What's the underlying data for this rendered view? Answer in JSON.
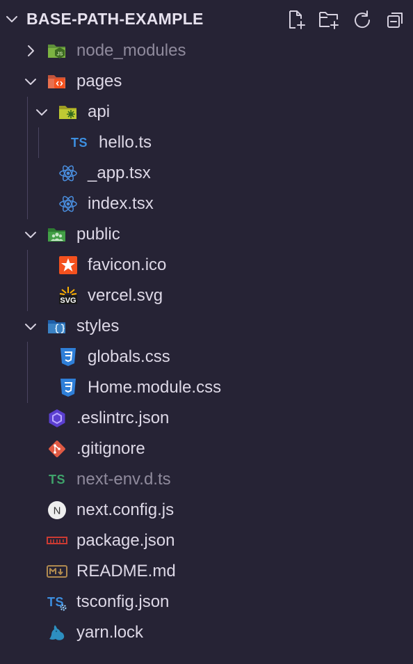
{
  "explorer": {
    "title": "BASE-PATH-EXAMPLE",
    "actions": [
      {
        "name": "new-file-button",
        "icon": "new-file-icon"
      },
      {
        "name": "new-folder-button",
        "icon": "new-folder-icon"
      },
      {
        "name": "refresh-button",
        "icon": "refresh-icon"
      },
      {
        "name": "collapse-all-button",
        "icon": "collapse-all-icon"
      }
    ]
  },
  "tree": [
    {
      "label": "node_modules",
      "type": "folder",
      "expanded": false,
      "icon": "nodejs-folder-icon",
      "dimmed": true
    },
    {
      "label": "pages",
      "type": "folder",
      "expanded": true,
      "icon": "pages-folder-icon"
    },
    {
      "label": "api",
      "type": "folder",
      "expanded": true,
      "icon": "api-folder-icon"
    },
    {
      "label": "hello.ts",
      "type": "file",
      "icon": "typescript-icon"
    },
    {
      "label": "_app.tsx",
      "type": "file",
      "icon": "react-icon"
    },
    {
      "label": "index.tsx",
      "type": "file",
      "icon": "react-icon"
    },
    {
      "label": "public",
      "type": "folder",
      "expanded": true,
      "icon": "public-folder-icon"
    },
    {
      "label": "favicon.ico",
      "type": "file",
      "icon": "favicon-icon"
    },
    {
      "label": "vercel.svg",
      "type": "file",
      "icon": "svg-icon",
      "icon_text": "SVG"
    },
    {
      "label": "styles",
      "type": "folder",
      "expanded": true,
      "icon": "styles-folder-icon"
    },
    {
      "label": "globals.css",
      "type": "file",
      "icon": "css-icon"
    },
    {
      "label": "Home.module.css",
      "type": "file",
      "icon": "css-icon"
    },
    {
      "label": ".eslintrc.json",
      "type": "file",
      "icon": "eslint-icon"
    },
    {
      "label": ".gitignore",
      "type": "file",
      "icon": "git-icon"
    },
    {
      "label": "next-env.d.ts",
      "type": "file",
      "icon": "typescript-def-icon",
      "dimmed": true
    },
    {
      "label": "next.config.js",
      "type": "file",
      "icon": "nextjs-icon",
      "icon_text": "N"
    },
    {
      "label": "package.json",
      "type": "file",
      "icon": "npm-icon"
    },
    {
      "label": "README.md",
      "type": "file",
      "icon": "markdown-icon"
    },
    {
      "label": "tsconfig.json",
      "type": "file",
      "icon": "tsconfig-icon"
    },
    {
      "label": "yarn.lock",
      "type": "file",
      "icon": "yarn-icon"
    }
  ],
  "icon_text": {
    "ts": "TS"
  },
  "colors": {
    "background": "#262335",
    "text": "#ddd8e6",
    "dimmed_text": "#8f8a9c",
    "typescript": "#3d8fe0",
    "typescript_def": "#3fa36b",
    "css": "#2f7fd8",
    "react": "#4a8fe0",
    "git": "#e05a44",
    "eslint": "#5b3fd0",
    "npm": "#cc3b33",
    "yarn": "#2d8fc0"
  }
}
